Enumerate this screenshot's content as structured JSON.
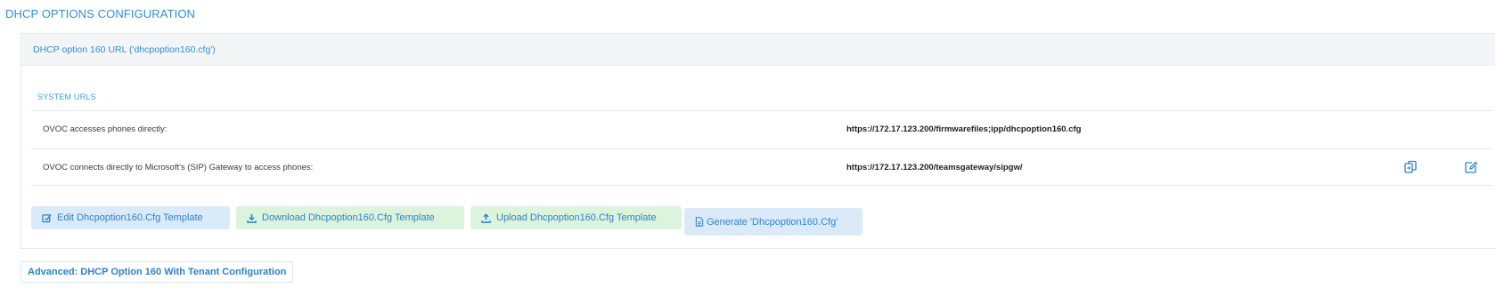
{
  "page": {
    "title": "DHCP OPTIONS CONFIGURATION"
  },
  "panel": {
    "header": "DHCP option 160 URL ('dhcpoption160.cfg')",
    "section_label": "SYSTEM URLS",
    "rows": [
      {
        "label": "OVOC accesses phones directly:",
        "value": "https://172.17.123.200/firmwarefiles;ipp/dhcpoption160.cfg"
      },
      {
        "label": "OVOC connects directly to Microsoft's (SIP) Gateway to access phones:",
        "value": "https://172.17.123.200/teamsgateway/sipgw/",
        "icons": [
          "copy-icon",
          "edit-icon"
        ]
      }
    ],
    "buttons": {
      "edit": "Edit Dhcpoption160.Cfg Template",
      "download": "Download Dhcpoption160.Cfg Template",
      "upload": "Upload Dhcpoption160.Cfg Template",
      "generate": "Generate 'Dhcpoption160.Cfg'"
    }
  },
  "advanced_button": "Advanced: DHCP Option 160 With Tenant Configuration",
  "colors": {
    "accent": "#2e8fd8",
    "blue_button_bg": "#dbeaf8",
    "green_button_bg": "#dcf3dc",
    "header_bg": "#f4f5f6"
  }
}
